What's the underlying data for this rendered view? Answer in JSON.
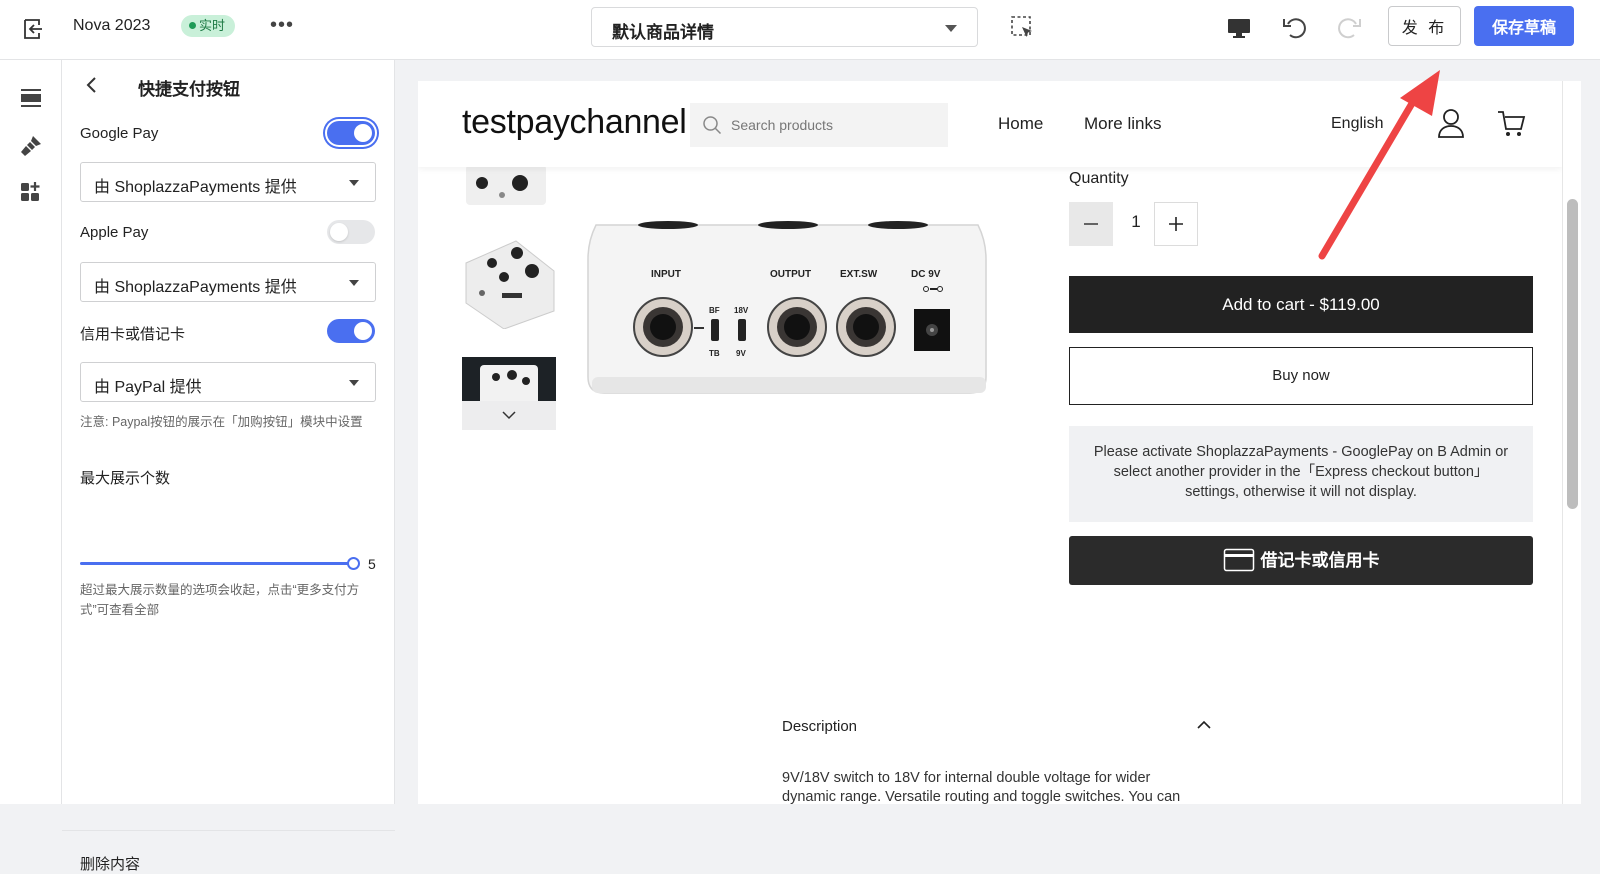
{
  "topbar": {
    "theme_name": "Nova 2023",
    "live_badge": "实时",
    "more_label": "•••",
    "page_select": "默认商品详情",
    "publish_label": "发 布",
    "save_draft_label": "保存草稿"
  },
  "panel": {
    "title": "快捷支付按钮",
    "google_pay": {
      "label": "Google Pay",
      "enabled": true,
      "provider": "由 ShoplazzaPayments 提供"
    },
    "apple_pay": {
      "label": "Apple Pay",
      "enabled": false,
      "provider": "由 ShoplazzaPayments 提供"
    },
    "card": {
      "label": "信用卡或借记卡",
      "enabled": true,
      "provider": "由 PayPal 提供"
    },
    "note": "注意: Paypal按钮的展示在「加购按钮」模块中设置",
    "max_label": "最大展示个数",
    "max_value": "5",
    "max_note": "超过最大展示数量的选项会收起，点击“更多支付方式”可查看全部",
    "delete_label": "删除内容"
  },
  "preview": {
    "logo": "testpaychannel",
    "search_placeholder": "Search products",
    "nav": [
      "Home",
      "More links"
    ],
    "language": "English",
    "pedal_labels": {
      "input": "INPUT",
      "output": "OUTPUT",
      "ext_sw": "EXT.SW",
      "dc": "DC 9V",
      "bf": "BF",
      "tb": "TB",
      "v18": "18V",
      "v9": "9V"
    },
    "quantity_label": "Quantity",
    "quantity_value": "1",
    "add_to_cart": "Add to cart  -  $119.00",
    "buy_now": "Buy now",
    "notice": "Please activate ShoplazzaPayments - GooglePay on B Admin or select another provider in the「Express checkout button」 settings, otherwise it will not display.",
    "card_button": "借记卡或信用卡",
    "description_title": "Description",
    "description_text": "9V/18V switch to 18V for internal double voltage for wider dynamic range. Versatile routing and toggle switches. You can"
  },
  "colors": {
    "accent": "#4a6ff0",
    "badge_bg": "#c9f0d9",
    "badge_text": "#1e7a45",
    "annotation_arrow": "#ee4444"
  },
  "icons": [
    "exit-icon",
    "more-icon",
    "chevron-down-icon",
    "select-cursor-icon",
    "desktop-icon",
    "undo-icon",
    "redo-icon",
    "sections-icon",
    "theme-brush-icon",
    "apps-icon",
    "back-arrow-icon",
    "search-icon",
    "user-icon",
    "cart-icon",
    "minus-icon",
    "plus-icon",
    "credit-card-icon",
    "chevron-up-icon"
  ]
}
